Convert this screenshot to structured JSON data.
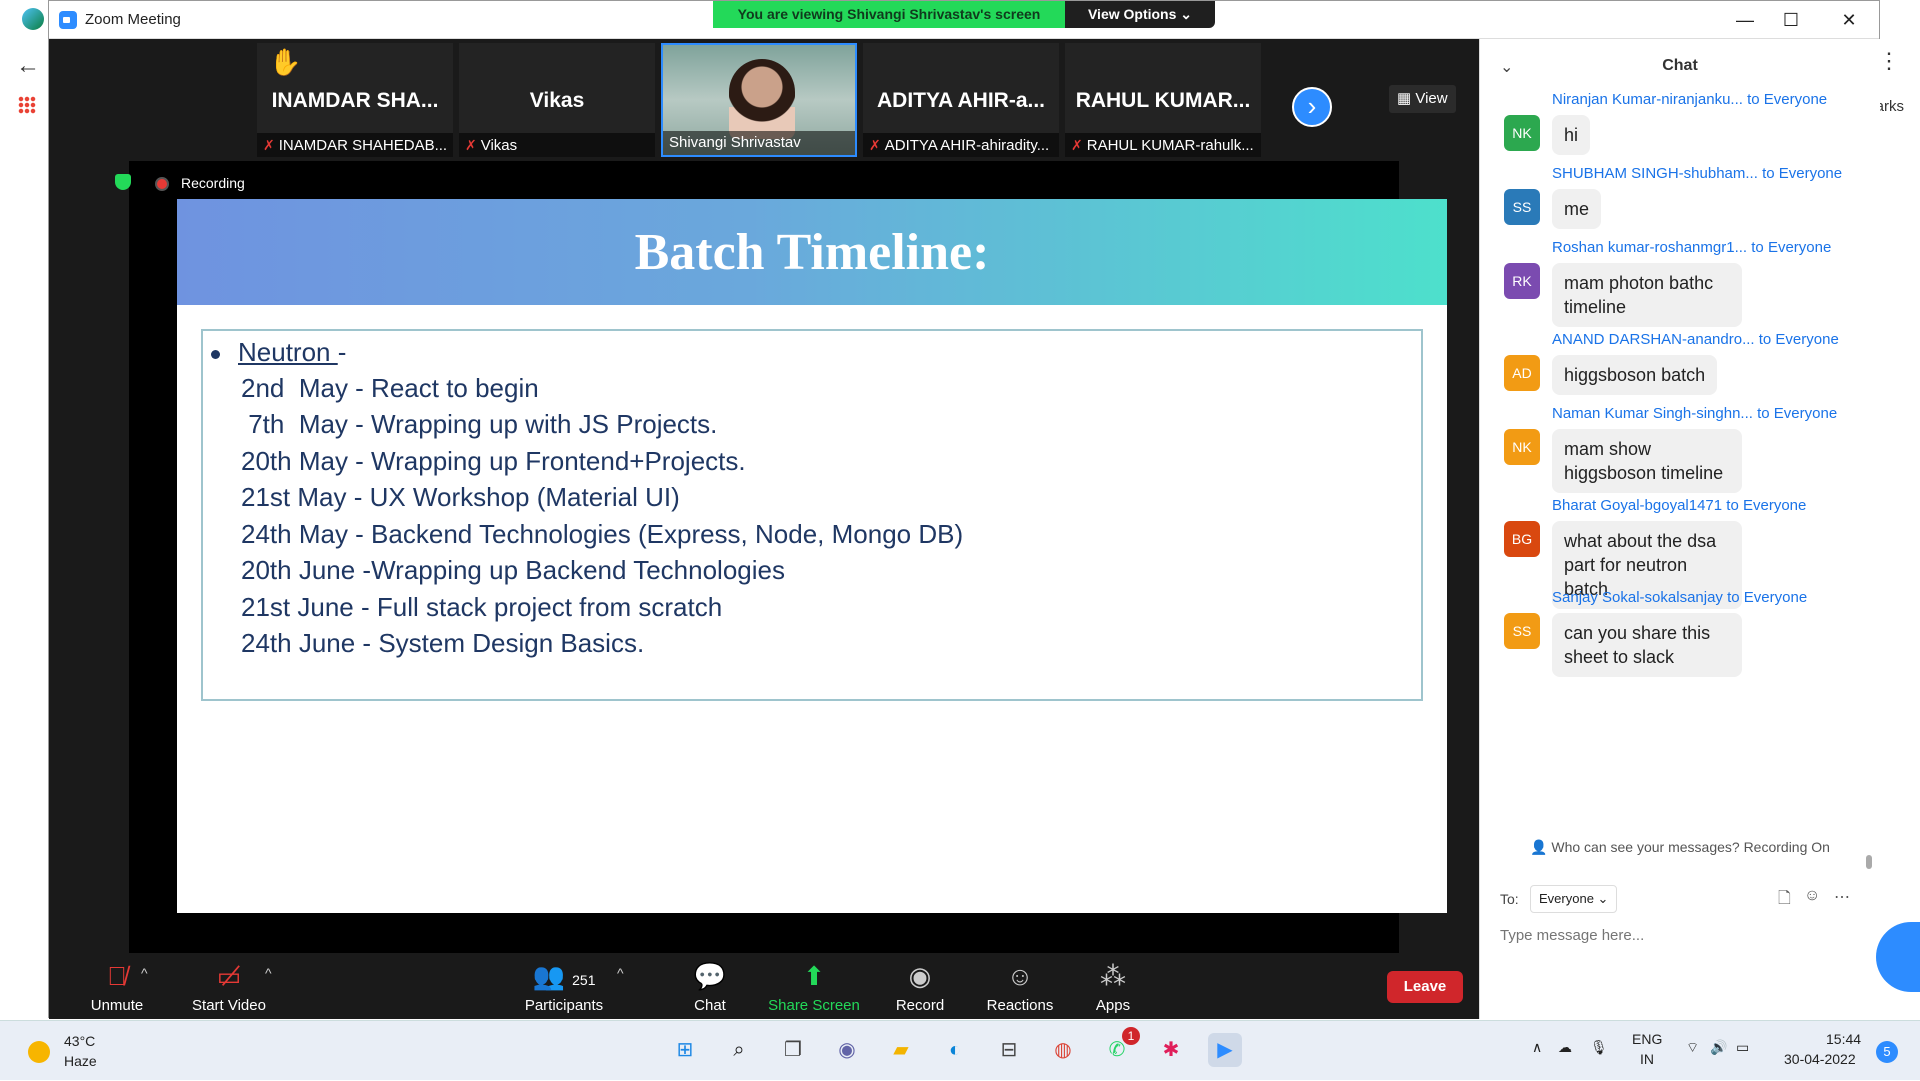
{
  "browser": {
    "partial_text": "arks"
  },
  "window": {
    "title": "Zoom Meeting"
  },
  "banner": {
    "viewing": "You are viewing Shivangi Shrivastav's screen",
    "view_options": "View Options ⌄"
  },
  "video_strip": {
    "tiles": [
      {
        "big_name": "INAMDAR SHA...",
        "label": "INAMDAR SHAHEDAB...",
        "raised_hand": "✋"
      },
      {
        "big_name": "Vikas",
        "label": "Vikas"
      },
      {
        "label": "Shivangi Shrivastav"
      },
      {
        "big_name": "ADITYA AHIR-a...",
        "label": "ADITYA AHIR-ahiradity..."
      },
      {
        "big_name": "RAHUL KUMAR...",
        "label": "RAHUL KUMAR-rahulk..."
      }
    ],
    "view_label": "View"
  },
  "recording": {
    "label": "Recording"
  },
  "slide": {
    "title": "Batch Timeline:",
    "heading": "Neutron ",
    "heading_suffix": "-",
    "lines": [
      "2nd  May - React to begin",
      " 7th  May - Wrapping up with JS Projects.",
      "20th May - Wrapping up Frontend+Projects.",
      "21st May - UX Workshop (Material UI)",
      "24th May - Backend Technologies (Express, Node, Mongo DB)",
      "20th June -Wrapping up Backend Technologies",
      "21st June - Full stack project from scratch",
      "24th June - System Design Basics."
    ]
  },
  "toolbar": {
    "unmute": "Unmute",
    "start_video": "Start Video",
    "participants_count": "251",
    "participants": "Participants",
    "chat": "Chat",
    "share_screen": "Share Screen",
    "record": "Record",
    "reactions": "Reactions",
    "apps": "Apps",
    "leave": "Leave"
  },
  "chat": {
    "title": "Chat",
    "to_everyone": "to Everyone",
    "messages": [
      {
        "sender": "Niranjan Kumar-niranjanku...",
        "initials": "NK",
        "color": "#2ca84f",
        "text": "hi"
      },
      {
        "sender": "SHUBHAM SINGH-shubham...",
        "initials": "SS",
        "color": "#2a7ab8",
        "text": "me"
      },
      {
        "sender": "Roshan kumar-roshanmgr1...",
        "initials": "RK",
        "color": "#7b4bb0",
        "text": "mam photon bathc timeline"
      },
      {
        "sender": "ANAND DARSHAN-anandro...",
        "initials": "AD",
        "color": "#f29b14",
        "text": "higgsboson batch"
      },
      {
        "sender": "Naman Kumar Singh-singhn...",
        "initials": "NK",
        "color": "#f29b14",
        "text": "mam show higgsboson timeline"
      },
      {
        "sender": "Bharat Goyal-bgoyal1471",
        "initials": "BG",
        "color": "#d9480f",
        "text": "what about the dsa part for neutron batch"
      },
      {
        "sender": "Sanjay Sokal-sokalsanjay",
        "initials": "SS",
        "color": "#f29b14",
        "text": "can you share this sheet to slack"
      }
    ],
    "privacy_note": "Who can see your messages? Recording On",
    "to_label": "To:",
    "recipient": "Everyone",
    "input_placeholder": "Type message here..."
  },
  "taskbar": {
    "temperature": "43°C",
    "condition": "Haze",
    "whatsapp_badge": "1",
    "lang_top": "ENG",
    "lang_bottom": "IN",
    "time": "15:44",
    "date": "30-04-2022",
    "notifications": "5"
  }
}
